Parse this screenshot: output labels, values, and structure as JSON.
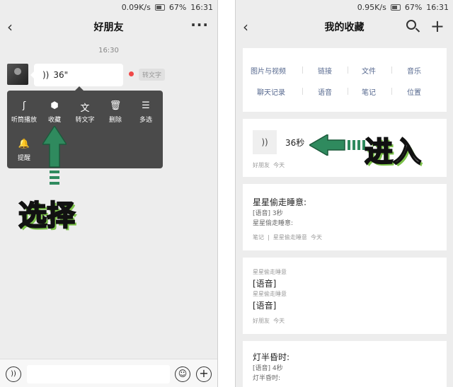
{
  "left": {
    "status": {
      "speed": "0.09K/s",
      "battery": "67%",
      "time": "16:31"
    },
    "header": {
      "back": "‹",
      "title": "好朋友",
      "more": "···"
    },
    "chat_time": "16:30",
    "voice_message": {
      "icon": "))",
      "duration": "36\""
    },
    "to_text_chip": "转文字",
    "context_menu": {
      "items": [
        {
          "icon": "ear-icon",
          "glyph": "ʃ",
          "label": "听筒播放"
        },
        {
          "icon": "cube-icon",
          "glyph": "⬢",
          "label": "收藏"
        },
        {
          "icon": "text-icon",
          "glyph": "文",
          "label": "转文字"
        },
        {
          "icon": "trash-icon",
          "glyph": "🗑",
          "label": "删除"
        },
        {
          "icon": "list-icon",
          "glyph": "☰",
          "label": "多选"
        },
        {
          "icon": "bell-icon",
          "glyph": "🔔",
          "label": "提醒"
        }
      ]
    },
    "annotation": "选择",
    "bottom": {
      "voice": "))",
      "emoji": "☺",
      "plus": "+"
    }
  },
  "right": {
    "status": {
      "speed": "0.95K/s",
      "battery": "67%",
      "time": "16:31"
    },
    "header": {
      "back": "‹",
      "title": "我的收藏",
      "plus": "+"
    },
    "categories": [
      "图片与视频",
      "链接",
      "文件",
      "音乐",
      "聊天记录",
      "语音",
      "笔记",
      "位置"
    ],
    "annotation": "进入",
    "items": [
      {
        "voice_icon": "))",
        "length": "36秒",
        "source": "好朋友",
        "date": "今天"
      },
      {
        "title": "星星偷走睡意:",
        "line1": "[语音] 3秒",
        "line2": "星星偷走睡意:",
        "tag": "笔记",
        "sep": "|",
        "source": "星星偷走睡意",
        "date": "今天"
      },
      {
        "pre1": "星星偷走睡意",
        "v1": "[语音]",
        "pre2": "星星偷走睡意",
        "v2": "[语音]",
        "source": "好朋友",
        "date": "今天"
      },
      {
        "title": "灯半昏时:",
        "line1": "[语音] 4秒",
        "line2": "灯半昏时:"
      }
    ]
  },
  "colors": {
    "arrow": "#2f8a5e",
    "arrow_dark": "#1d5a3c",
    "text_shadow": "#7cc24a",
    "red_dot": "#f04848",
    "link_blue": "#57698f"
  }
}
